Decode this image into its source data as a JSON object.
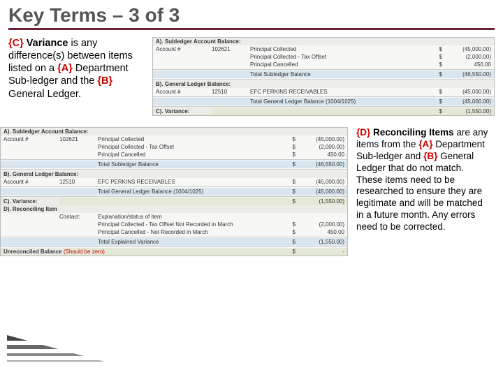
{
  "title": "Key Terms – 3 of 3",
  "text_c": {
    "tag": "{C}",
    "head": "Variance",
    "body_a": " is any difference(s) between items listed on a ",
    "tag_a": "{A}",
    "body_b": " Department Sub-ledger and the ",
    "tag_b": "{B}",
    "body_c": " General Ledger."
  },
  "text_d": {
    "tag": "{D}",
    "head": "Reconciling Items",
    "body_a": " are any items from the ",
    "tag_a": "{A}",
    "body_b": " Department Sub-ledger and ",
    "tag_b": "{B}",
    "body_c": " General Ledger that do not match.  These items need to be researched to ensure they are legitimate and will be matched in a future month.  Any errors need to be corrected."
  },
  "p1": {
    "secA": "A). Subledger Account Balance:",
    "acct": "Account #",
    "acctA": "102621",
    "pc": "Principal Collected",
    "pcv": "(45,000.00)",
    "pct": "Principal Collected - Tax Offset",
    "pctv": "(2,000.00)",
    "pcn": "Principal Cancelled",
    "pcnv": "450.00",
    "tsb": "Total Subledger Balance",
    "tsbv": "(46,550.00)",
    "dol": "$",
    "secB": "B). General Ledger Balance:",
    "acctB": "12510",
    "efc": "EFC PERKINS RECEIVABLES",
    "efcv": "(45,000.00)",
    "tgl": "Total General Ledger Balance (1004/1025)",
    "tglv": "(45,000.00)",
    "secC": "C). Variance:",
    "varv": "(1,550.00)"
  },
  "p2": {
    "secA": "A). Subledger Account Balance:",
    "acct": "Account #",
    "acctA": "102621",
    "pc": "Principal Collected",
    "pcv": "(45,000.00)",
    "pct": "Principal Collected - Tax Offset",
    "pctv": "(2,000.00)",
    "pcn": "Principal Cancelled",
    "pcnv": "450.00",
    "tsb": "Total Subledger Balance",
    "tsbv": "(46,550.00)",
    "dol": "$",
    "secB": "B). General Ledger Balance:",
    "acctB": "12510",
    "efc": "EFC PERKINS RECEIVABLES",
    "efcv": "(45,000.00)",
    "tgl": "Total General Ledger Balance (1004/1025)",
    "tglv": "(45,000.00)",
    "secC": "C). Variance:",
    "varv": "(1,550.00)",
    "secD": "D). Reconciling Item",
    "cont": "Contact:",
    "expl": "Explanation/status of item",
    "r1": "Principal Collected - Tax Offset Not Recorded in March",
    "r1v": "(2,000.00)",
    "r2": "Principal Cancelled - Not Recorded in March",
    "r2v": "450.00",
    "tev": "Total Explained Variance",
    "tevv": "(1,550.00)",
    "unrec": "Unreconciled Balance ",
    "unrecz": "(Should be zero)",
    "unrecv": "-"
  }
}
